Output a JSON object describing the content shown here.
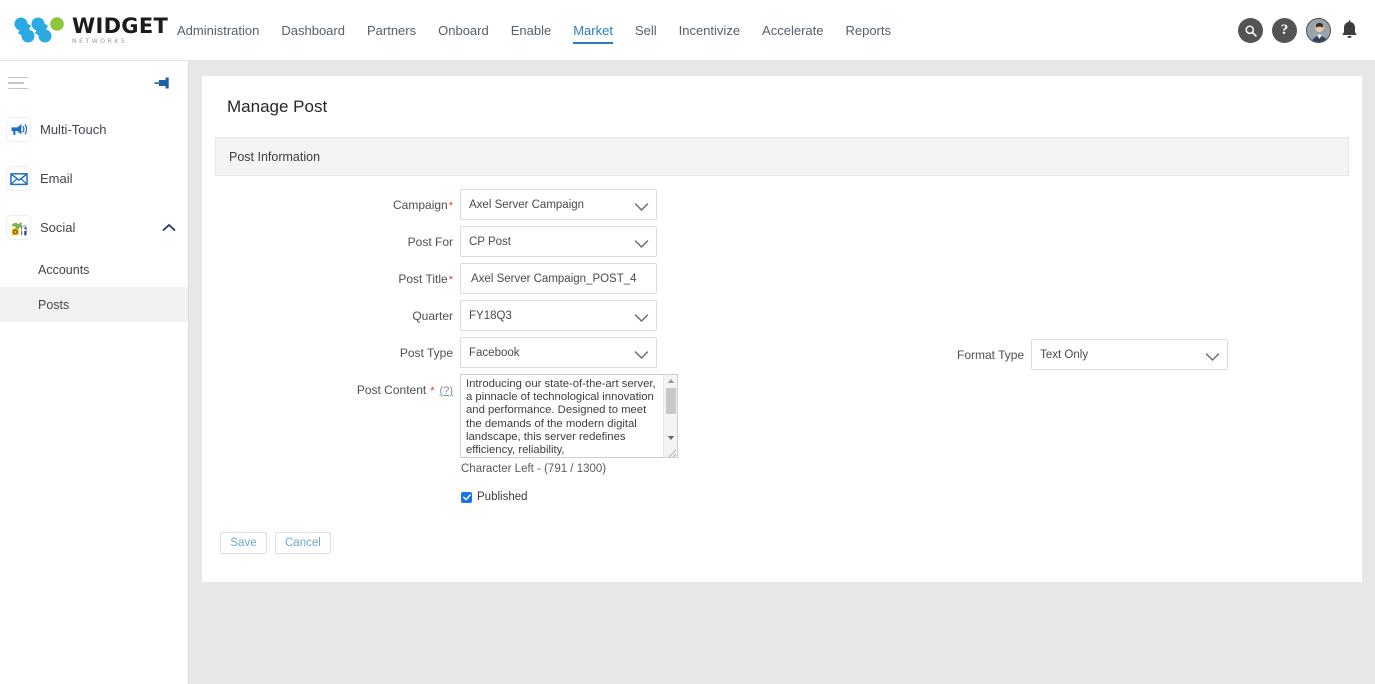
{
  "brand": {
    "name": "WIDGET",
    "tagline": "NETWORKS",
    "accent_blue": "#2b7cc4",
    "logo_blue": "#29abe2",
    "logo_green": "#8cc63f"
  },
  "topnav": {
    "items": [
      {
        "label": "Administration",
        "active": false
      },
      {
        "label": "Dashboard",
        "active": false
      },
      {
        "label": "Partners",
        "active": false
      },
      {
        "label": "Onboard",
        "active": false
      },
      {
        "label": "Enable",
        "active": false
      },
      {
        "label": "Market",
        "active": true
      },
      {
        "label": "Sell",
        "active": false
      },
      {
        "label": "Incentivize",
        "active": false
      },
      {
        "label": "Accelerate",
        "active": false
      },
      {
        "label": "Reports",
        "active": false
      }
    ],
    "icons": [
      {
        "name": "search-icon"
      },
      {
        "name": "help-icon"
      },
      {
        "name": "avatar"
      },
      {
        "name": "notifications-bell-icon"
      }
    ]
  },
  "sidebar": {
    "menu_icon": "hamburger-icon",
    "pin_icon": "pin-icon",
    "items": [
      {
        "label": "Multi-Touch",
        "icon": "megaphone-icon",
        "expandable": false
      },
      {
        "label": "Email",
        "icon": "envelope-icon",
        "expandable": false
      },
      {
        "label": "Social",
        "icon": "social-icon",
        "expandable": true,
        "expanded": true
      }
    ],
    "subitems": [
      {
        "label": "Accounts",
        "active": false
      },
      {
        "label": "Posts",
        "active": true
      }
    ]
  },
  "main": {
    "page_title": "Manage Post",
    "section_title": "Post Information",
    "fields": {
      "campaign": {
        "label": "Campaign",
        "required": true,
        "value": "Axel Server Campaign",
        "type": "select"
      },
      "post_for": {
        "label": "Post For",
        "required": false,
        "value": "CP Post",
        "type": "select"
      },
      "post_title": {
        "label": "Post Title",
        "required": true,
        "value": "Axel Server Campaign_POST_4",
        "type": "text"
      },
      "quarter": {
        "label": "Quarter",
        "required": false,
        "value": "FY18Q3",
        "type": "select"
      },
      "post_type": {
        "label": "Post Type",
        "required": false,
        "value": "Facebook",
        "type": "select"
      },
      "format_type": {
        "label": "Format Type",
        "required": false,
        "value": "Text Only",
        "type": "select"
      },
      "post_content": {
        "label": "Post Content",
        "required": true,
        "help_label": "(?)",
        "value": "Introducing our state-of-the-art server, a pinnacle of technological innovation and performance. Designed to meet the demands of the modern digital landscape, this server redefines efficiency, reliability,",
        "character_count": "Character Left - (791 / 1300)"
      },
      "published": {
        "label": "Published",
        "checked": true
      }
    },
    "buttons": {
      "save": "Save",
      "cancel": "Cancel"
    }
  }
}
